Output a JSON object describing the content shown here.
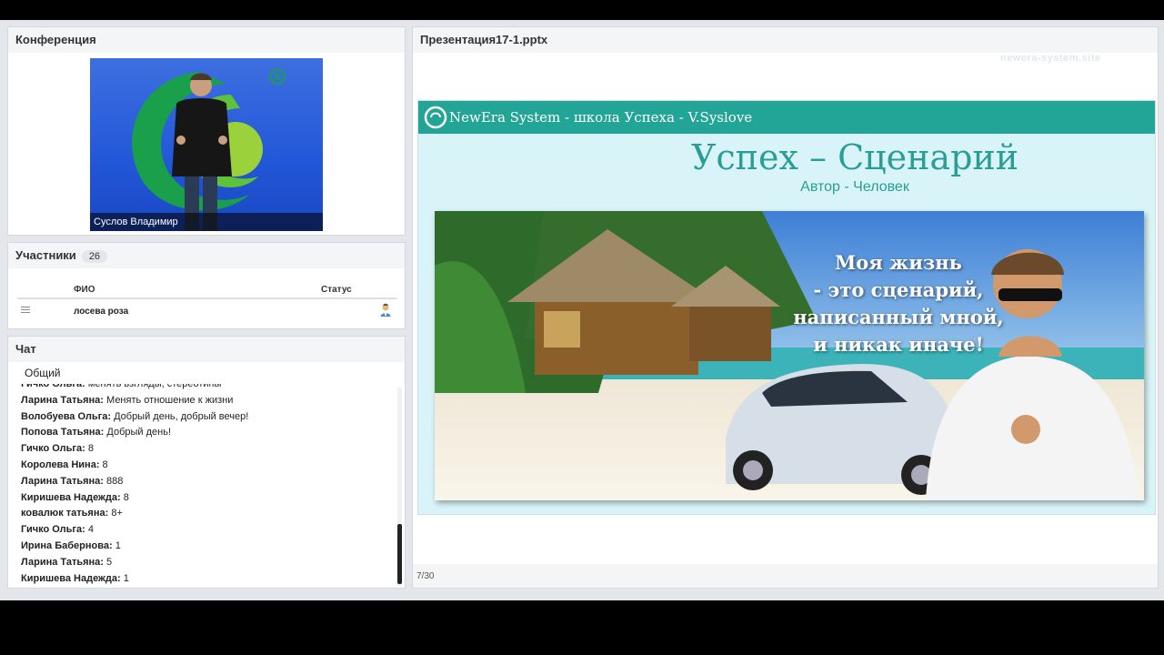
{
  "conference": {
    "title": "Конференция",
    "speaker_name": "Суслов Владимир"
  },
  "participants": {
    "title": "Участники",
    "count": "26",
    "col_name": "ФИО",
    "col_status": "Статус",
    "rows": [
      {
        "name": "лосева роза",
        "status_icon": "user-icon"
      }
    ]
  },
  "chat": {
    "title": "Чат",
    "tab": "Общий",
    "messages": [
      {
        "author": "Гичко Ольга:",
        "text": "менять взгляды, стереотипы"
      },
      {
        "author": "Ларина Татьяна:",
        "text": "Менять отношение к жизни"
      },
      {
        "author": "Волобуева  Ольга:",
        "text": "Добрый день, добрый вечер!"
      },
      {
        "author": "Попова Татьяна:",
        "text": "Добрый день!"
      },
      {
        "author": "Гичко Ольга:",
        "text": "8"
      },
      {
        "author": "Королева Нина:",
        "text": "8"
      },
      {
        "author": "Ларина Татьяна:",
        "text": "888"
      },
      {
        "author": "Киришева Надежда:",
        "text": "8"
      },
      {
        "author": "ковалюк татьяна:",
        "text": "8+"
      },
      {
        "author": "Гичко Ольга:",
        "text": "4"
      },
      {
        "author": "Ирина Бабернова:",
        "text": "1"
      },
      {
        "author": "Ларина Татьяна:",
        "text": "5"
      },
      {
        "author": "Киришева Надежда:",
        "text": "1"
      }
    ]
  },
  "presentation": {
    "title": "Презентация17-1.pptx",
    "watermark": "newera-system.site",
    "page": "7/30",
    "slide": {
      "brand": "NewEra System - школа Успеха - V.Syslove",
      "title": "Успех – Сценарий",
      "subtitle": "Автор - Человек",
      "photo_text": [
        "Моя жизнь",
        "- это сценарий,",
        "написанный мной,",
        "и никак иначе!"
      ]
    }
  },
  "colors": {
    "teal": "#22a597",
    "panel_bg": "#ffffff",
    "app_bg": "#e3e6ea"
  }
}
